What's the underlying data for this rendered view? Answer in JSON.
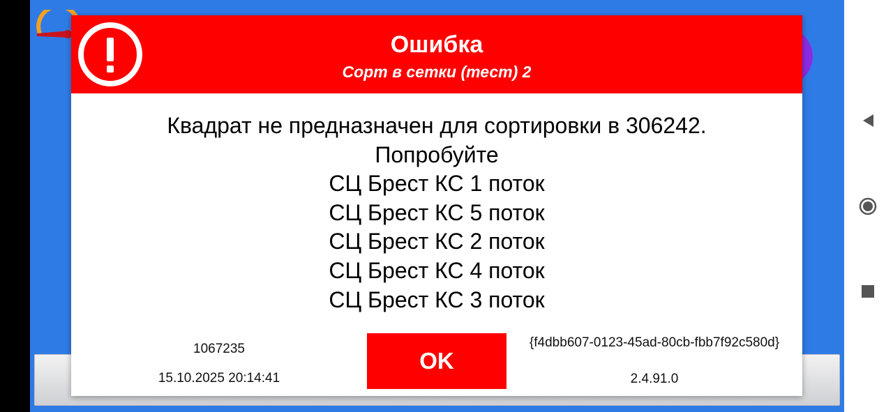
{
  "dialog": {
    "title": "Ошибка",
    "subtitle": "Сорт в сетки (тест) 2",
    "message_lines": [
      "Квадрат не предназначен для сортировки в 306242.",
      "Попробуйте",
      "СЦ Брест КС 1 поток",
      "СЦ Брест КС 5 поток",
      "СЦ Брест КС 2 поток",
      "СЦ Брест КС 4 поток",
      "СЦ Брест КС 3 поток"
    ],
    "code": "1067235",
    "datetime": "15.10.2025 20:14:41",
    "ok_label": "OK",
    "guid": "{f4dbb607-0123-45ad-80cb-fbb7f92c580d}",
    "version": "2.4.91.0"
  },
  "icons": {
    "header_icon": "exclamation-circle-icon",
    "gauge": "gauge-icon",
    "nav_back": "back-triangle-icon",
    "nav_home": "home-circle-icon",
    "nav_recents": "recents-square-icon"
  },
  "colors": {
    "error_red": "#ff0000",
    "app_blue": "#2f7be6",
    "purple": "#8a2be2",
    "text_white": "#ffffff",
    "text_dark": "#000000",
    "nav_icon": "#555555"
  }
}
